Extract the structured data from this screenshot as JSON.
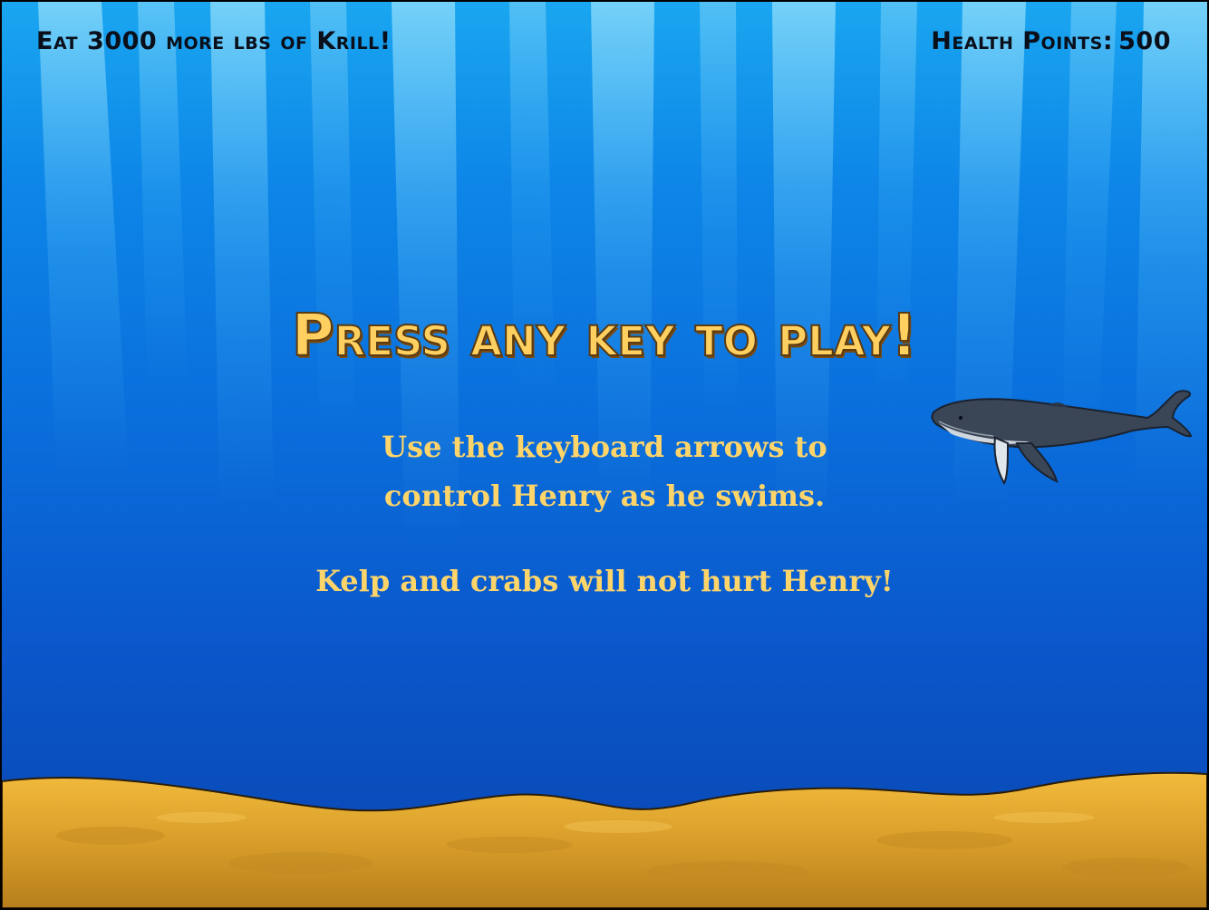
{
  "hud": {
    "krill_goal": "Eat 3000 more lbs of Krill!",
    "health_label": "Health Points:",
    "health_value": "500"
  },
  "screen": {
    "title": "Press any key to play!",
    "instructions": [
      "Use the keyboard arrows to",
      "control Henry as he swims.",
      "Kelp and crabs will not hurt Henry!"
    ]
  },
  "colors": {
    "water_top": "#1aa6f0",
    "water_bottom": "#0a45b0",
    "sand": "#e0a830",
    "text_yellow": "#ffd56a",
    "whale_body": "#3a4556"
  },
  "sprites": {
    "player": "whale-icon"
  }
}
